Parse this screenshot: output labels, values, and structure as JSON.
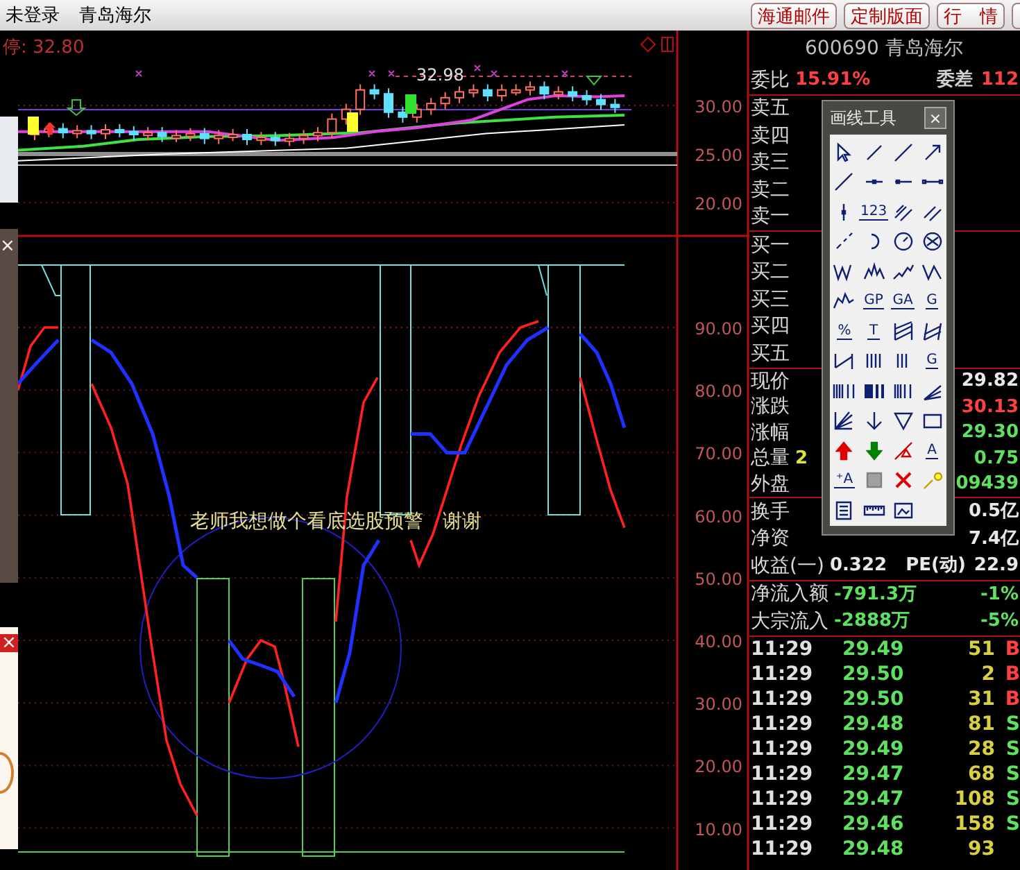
{
  "top_bar": {
    "status": "未登录",
    "stock_name": "青岛海尔",
    "buttons": [
      "海通邮件",
      "定制版面",
      "行　情"
    ]
  },
  "price_chart": {
    "limit_label": "停: 32.80",
    "peak_label": "32.98",
    "axis_labels": [
      "30.00",
      "25.00",
      "20.00"
    ]
  },
  "indicator_chart": {
    "note": "老师我想做个看底选股预警　谢谢",
    "axis_labels": [
      "90.00",
      "80.00",
      "70.00",
      "60.00",
      "50.00",
      "40.00",
      "30.00",
      "20.00",
      "10.00"
    ]
  },
  "quote_panel": {
    "title": "600690 青岛海尔",
    "ratio_row": {
      "label": "委比",
      "values": [
        {
          "text": "15.91%",
          "color": "#ff4040"
        },
        {
          "text": "委差",
          "color": "#d0d0d0"
        },
        {
          "text": "112",
          "color": "#ff4040"
        }
      ]
    },
    "sell_levels": [
      "卖五",
      "卖四",
      "卖三",
      "卖二",
      "卖一"
    ],
    "buy_levels": [
      "买一",
      "买二",
      "买三",
      "买四",
      "买五"
    ],
    "stat_groups": [
      {
        "rows": [
          {
            "label": "现价",
            "values": [
              {
                "text": "29.82",
                "color": "#e8e8e8"
              }
            ]
          },
          {
            "label": "涨跌",
            "values": [
              {
                "text": "30.13",
                "color": "#ff4040"
              }
            ]
          },
          {
            "label": "涨幅",
            "values": [
              {
                "text": "29.30",
                "color": "#60e060"
              }
            ]
          },
          {
            "label": "总量",
            "values": [
              {
                "text": "2",
                "color": "#e0e040"
              },
              {
                "text": "0.75",
                "color": "#60e060"
              }
            ]
          },
          {
            "label": "外盘",
            "values": [
              {
                "text": "09439",
                "color": "#60e060"
              }
            ]
          }
        ]
      },
      {
        "rows": [
          {
            "label": "换手",
            "values": [
              {
                "text": "0.5亿",
                "color": "#e8e8e8"
              }
            ]
          },
          {
            "label": "净资",
            "values": [
              {
                "text": "7.4亿",
                "color": "#e8e8e8"
              }
            ]
          },
          {
            "label": "收益(一)",
            "values": [
              {
                "text": "0.322",
                "color": "#e8e8e8"
              },
              {
                "text": "PE(动)",
                "color": "#e8e8e8"
              },
              {
                "text": "22.9",
                "color": "#e8e8e8"
              }
            ]
          }
        ]
      },
      {
        "rows": [
          {
            "label": "净流入额",
            "values": [
              {
                "text": "-791.3万",
                "color": "#60e060"
              },
              {
                "text": "-1%",
                "color": "#60e060"
              }
            ]
          },
          {
            "label": "大宗流入",
            "values": [
              {
                "text": "-2888万",
                "color": "#60e060"
              },
              {
                "text": "-5%",
                "color": "#60e060"
              }
            ]
          }
        ]
      }
    ],
    "ticks": [
      {
        "time": "11:29",
        "price": "29.49",
        "volume": "51",
        "side": "B",
        "kind": "buy"
      },
      {
        "time": "11:29",
        "price": "29.50",
        "volume": "2",
        "side": "B",
        "kind": "buy"
      },
      {
        "time": "11:29",
        "price": "29.50",
        "volume": "31",
        "side": "B",
        "kind": "buy"
      },
      {
        "time": "11:29",
        "price": "29.48",
        "volume": "81",
        "side": "S",
        "kind": "sell"
      },
      {
        "time": "11:29",
        "price": "29.49",
        "volume": "28",
        "side": "S",
        "kind": "sell"
      },
      {
        "time": "11:29",
        "price": "29.47",
        "volume": "68",
        "side": "S",
        "kind": "sell"
      },
      {
        "time": "11:29",
        "price": "29.47",
        "volume": "108",
        "side": "S",
        "kind": "sell"
      },
      {
        "time": "11:29",
        "price": "29.46",
        "volume": "158",
        "side": "S",
        "kind": "sell"
      },
      {
        "time": "11:29",
        "price": "29.48",
        "volume": "93"
      }
    ]
  },
  "drawing_tools": {
    "title": "画线工具",
    "close": "×",
    "tools": [
      {
        "kind": "pointer"
      },
      {
        "kind": "segment"
      },
      {
        "kind": "line"
      },
      {
        "kind": "arrow-line"
      },
      {
        "kind": "slash"
      },
      {
        "kind": "hseg-dot"
      },
      {
        "kind": "hline-end"
      },
      {
        "kind": "hseg-both"
      },
      {
        "kind": "vline-dot"
      },
      {
        "kind": "label",
        "label": "123"
      },
      {
        "kind": "parallel"
      },
      {
        "kind": "parallel-dash"
      },
      {
        "kind": "dash-slash"
      },
      {
        "kind": "arc"
      },
      {
        "kind": "circle-line"
      },
      {
        "kind": "circle-x"
      },
      {
        "kind": "wave-w"
      },
      {
        "kind": "wave-m"
      },
      {
        "kind": "zigzag"
      },
      {
        "kind": "wave-n"
      },
      {
        "kind": "peaks"
      },
      {
        "kind": "label",
        "label": "GP"
      },
      {
        "kind": "label",
        "label": "GA"
      },
      {
        "kind": "label",
        "label": "G"
      },
      {
        "kind": "label",
        "label": "%"
      },
      {
        "kind": "label",
        "label": "T"
      },
      {
        "kind": "hatch"
      },
      {
        "kind": "hatch-slant"
      },
      {
        "kind": "bracket"
      },
      {
        "kind": "bars4"
      },
      {
        "kind": "bars3"
      },
      {
        "kind": "label",
        "label": "G"
      },
      {
        "kind": "bars-wide"
      },
      {
        "kind": "bars-bold"
      },
      {
        "kind": "bars-mix"
      },
      {
        "kind": "fan"
      },
      {
        "kind": "fan-lines"
      },
      {
        "kind": "down-v"
      },
      {
        "kind": "triangle"
      },
      {
        "kind": "rect"
      },
      {
        "kind": "up-arrow"
      },
      {
        "kind": "down-arrow"
      },
      {
        "kind": "line-arrow"
      },
      {
        "kind": "label",
        "label": "A"
      },
      {
        "kind": "label",
        "label": "⁺A"
      },
      {
        "kind": "square-fill"
      },
      {
        "kind": "cross"
      },
      {
        "kind": "bulb"
      },
      {
        "kind": "list"
      },
      {
        "kind": "ruler"
      },
      {
        "kind": "picture"
      }
    ]
  },
  "side_overlay": {
    "close_marks": [
      "×",
      "×"
    ]
  }
}
